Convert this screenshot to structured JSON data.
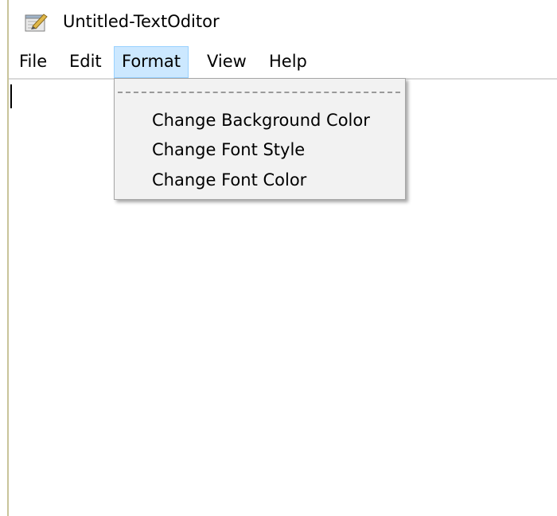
{
  "window": {
    "title": "Untitled-TextOditor",
    "icon": "notepad-icon"
  },
  "menubar": {
    "items": [
      {
        "label": "File"
      },
      {
        "label": "Edit"
      },
      {
        "label": "Format"
      },
      {
        "label": "View"
      },
      {
        "label": "Help"
      }
    ],
    "active_item": "Format"
  },
  "format_menu": {
    "items": [
      {
        "label": "Change Background Color"
      },
      {
        "label": "Change Font Style"
      },
      {
        "label": "Change Font Color"
      }
    ]
  },
  "editor": {
    "content": ""
  },
  "colors": {
    "menu_highlight": "#cce8ff",
    "menu_highlight_border": "#99d1ff",
    "dropdown_bg": "#f2f2f2"
  }
}
